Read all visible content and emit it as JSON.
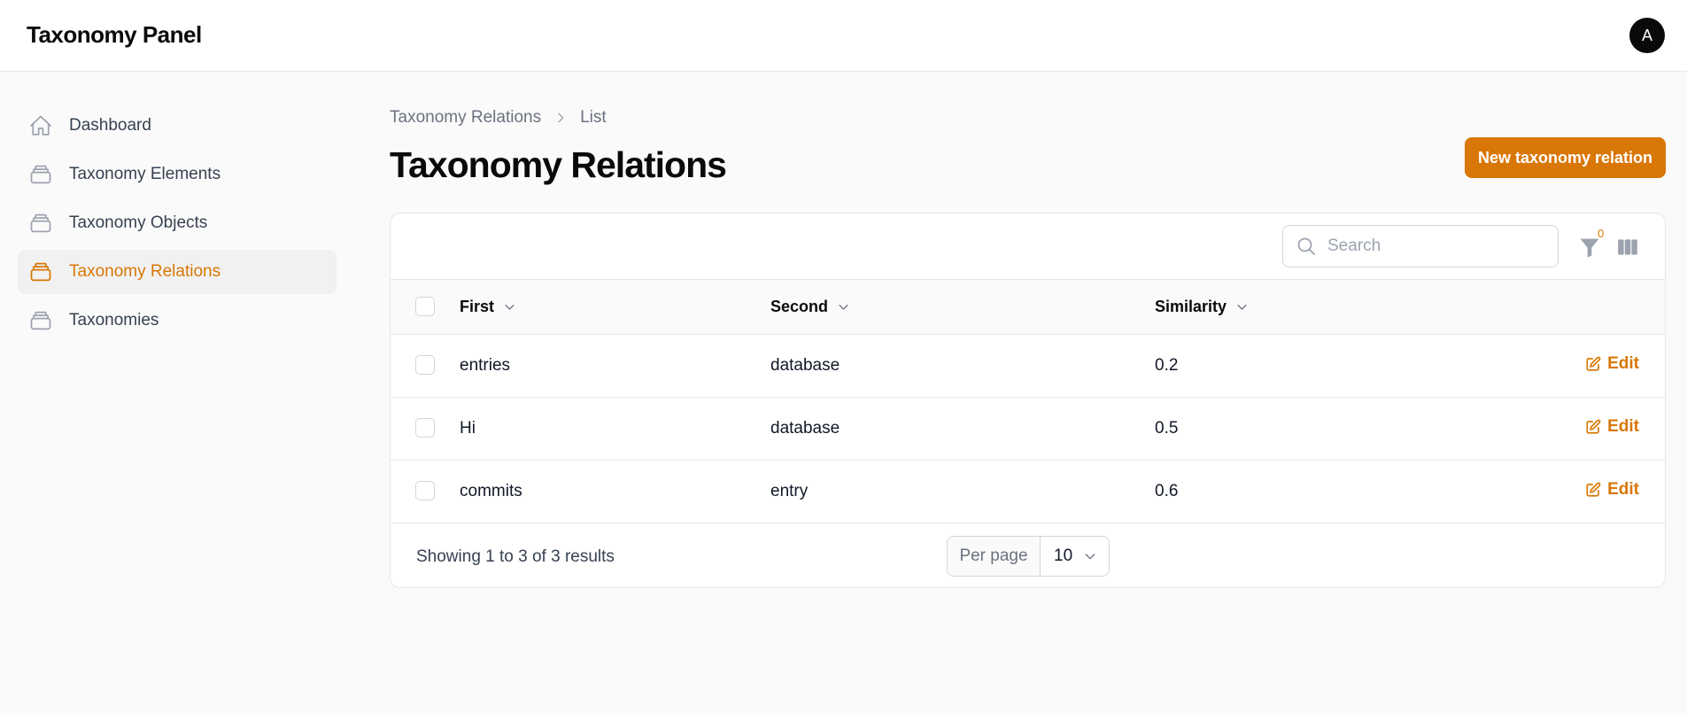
{
  "app": {
    "title": "Taxonomy Panel",
    "avatar_initial": "A"
  },
  "colors": {
    "accent": "#d97706",
    "text": "#111827",
    "muted": "#6b7280",
    "border": "#e5e7eb"
  },
  "sidebar": {
    "items": [
      {
        "label": "Dashboard",
        "icon": "home-icon",
        "active": false
      },
      {
        "label": "Taxonomy Elements",
        "icon": "stack-icon",
        "active": false
      },
      {
        "label": "Taxonomy Objects",
        "icon": "stack-icon",
        "active": false
      },
      {
        "label": "Taxonomy Relations",
        "icon": "stack-icon",
        "active": true
      },
      {
        "label": "Taxonomies",
        "icon": "stack-icon",
        "active": false
      }
    ]
  },
  "breadcrumb": {
    "parent": "Taxonomy Relations",
    "current": "List"
  },
  "page": {
    "title": "Taxonomy Relations",
    "new_button": "New taxonomy relation"
  },
  "table": {
    "search_placeholder": "Search",
    "filter_count": "0",
    "columns": [
      "First",
      "Second",
      "Similarity"
    ],
    "rows": [
      {
        "first": "entries",
        "second": "database",
        "similarity": "0.2",
        "action": "Edit"
      },
      {
        "first": "Hi",
        "second": "database",
        "similarity": "0.5",
        "action": "Edit"
      },
      {
        "first": "commits",
        "second": "entry",
        "similarity": "0.6",
        "action": "Edit"
      }
    ],
    "summary": "Showing 1 to 3 of 3 results",
    "per_page_label": "Per page",
    "per_page_value": "10"
  }
}
